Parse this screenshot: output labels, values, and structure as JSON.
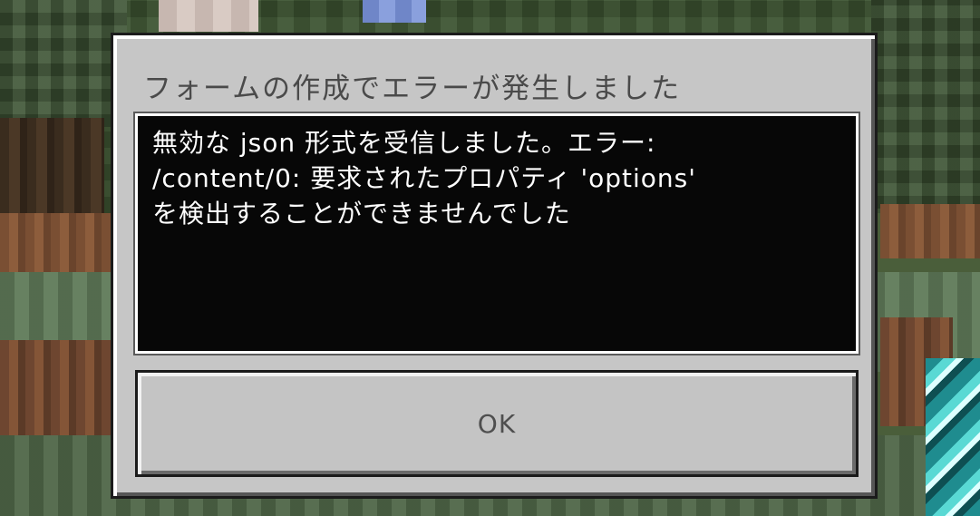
{
  "dialog": {
    "title": "フォームの作成でエラーが発生しました",
    "message": "無効な json 形式を受信しました。エラー:\n/content/0: 要求されたプロパティ 'options'\nを検出することができませんでした",
    "ok_label": "OK"
  },
  "colors": {
    "dialog_background": "#c6c6c6",
    "message_background": "#070707",
    "message_text": "#ffffff",
    "title_text": "#4a4a4a",
    "button_text": "#4f4f4f"
  }
}
